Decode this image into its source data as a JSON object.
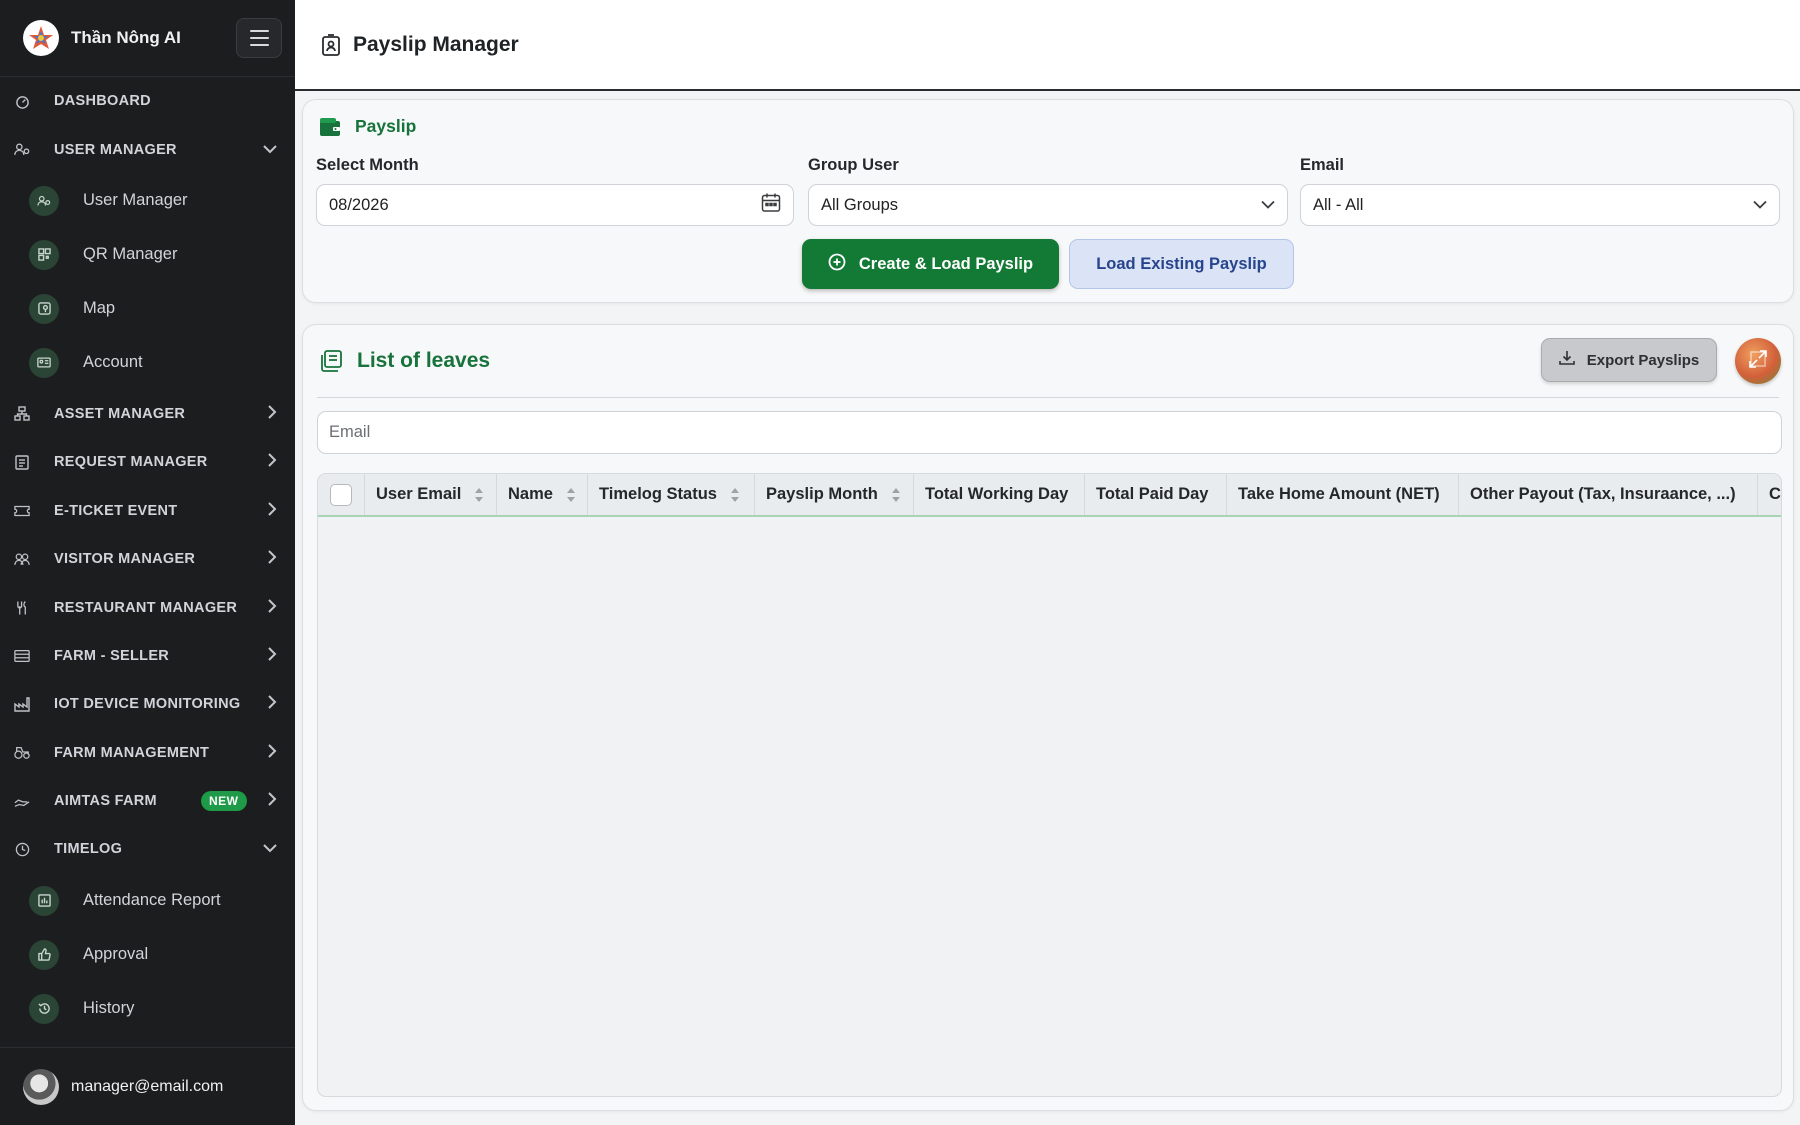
{
  "brand": {
    "name": "Thần Nông AI"
  },
  "sidebar": {
    "items": [
      {
        "label": "DASHBOARD",
        "icon": "dashboard-icon",
        "chevron": "none"
      },
      {
        "label": "USER MANAGER",
        "icon": "users-cog-icon",
        "chevron": "down",
        "children": [
          {
            "label": "User Manager",
            "icon": "users-cog-icon"
          },
          {
            "label": "QR Manager",
            "icon": "qr-icon"
          },
          {
            "label": "Map",
            "icon": "map-icon"
          },
          {
            "label": "Account",
            "icon": "id-card-icon"
          }
        ]
      },
      {
        "label": "ASSET MANAGER",
        "icon": "sitemap-icon",
        "chevron": "right"
      },
      {
        "label": "REQUEST MANAGER",
        "icon": "clipboard-icon",
        "chevron": "right"
      },
      {
        "label": "E-TICKET EVENT",
        "icon": "ticket-icon",
        "chevron": "right"
      },
      {
        "label": "VISITOR MANAGER",
        "icon": "visitors-icon",
        "chevron": "right"
      },
      {
        "label": "RESTAURANT MANAGER",
        "icon": "utensils-icon",
        "chevron": "right"
      },
      {
        "label": "FARM - SELLER",
        "icon": "store-icon",
        "chevron": "right"
      },
      {
        "label": "IOT DEVICE MONITORING",
        "icon": "factory-icon",
        "chevron": "right"
      },
      {
        "label": "FARM MANAGEMENT",
        "icon": "tractor-icon",
        "chevron": "right"
      },
      {
        "label": "AIMTAS FARM",
        "icon": "farm-hand-icon",
        "chevron": "right",
        "badge": "NEW"
      },
      {
        "label": "TIMELOG",
        "icon": "clock-icon",
        "chevron": "down",
        "children": [
          {
            "label": "Attendance Report",
            "icon": "bar-chart-icon"
          },
          {
            "label": "Approval",
            "icon": "thumbs-up-icon"
          },
          {
            "label": "History",
            "icon": "history-icon"
          }
        ]
      }
    ]
  },
  "user": {
    "email": "manager@email.com"
  },
  "header": {
    "title": "Payslip Manager",
    "icon": "id-badge-icon"
  },
  "payslip_card": {
    "title": "Payslip",
    "month_label": "Select Month",
    "month_value": "08/2026",
    "group_label": "Group User",
    "group_value": "All Groups",
    "email_label": "Email",
    "email_value": "All - All",
    "create_button": "Create & Load Payslip",
    "load_button": "Load Existing Payslip"
  },
  "list_card": {
    "title": "List of leaves",
    "export_button": "Export Payslips",
    "search_placeholder": "Email",
    "columns": [
      {
        "label": "User Email",
        "sortable": true
      },
      {
        "label": "Name",
        "sortable": true
      },
      {
        "label": "Timelog Status",
        "sortable": true
      },
      {
        "label": "Payslip Month",
        "sortable": true
      },
      {
        "label": "Total Working Day",
        "sortable": false
      },
      {
        "label": "Total Paid Day",
        "sortable": false
      },
      {
        "label": "Take Home Amount (NET)",
        "sortable": false
      },
      {
        "label": "Other Payout (Tax, Insuraance, ...)",
        "sortable": false
      },
      {
        "label": "C",
        "sortable": false
      }
    ],
    "rows": []
  },
  "colors": {
    "sidebar_bg": "#1c1d1f",
    "accent_green": "#127a35",
    "badge_green": "#1e9a48",
    "secondary_blue": "#dbe4f6"
  }
}
